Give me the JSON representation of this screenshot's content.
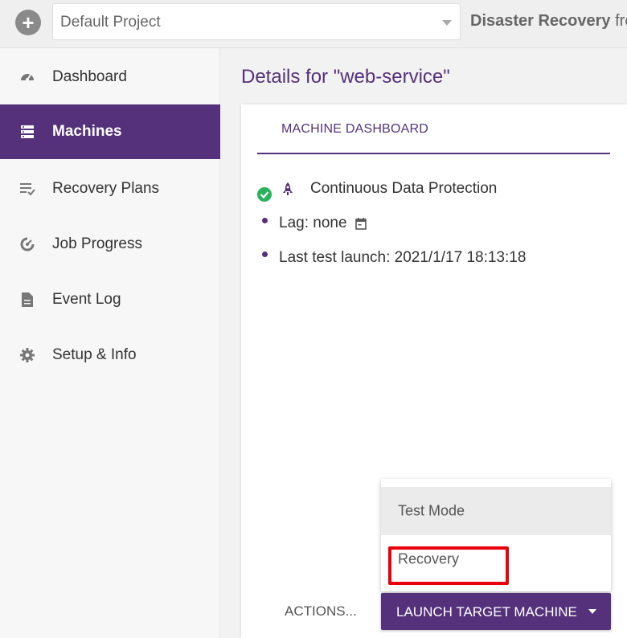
{
  "topbar": {
    "project_value": "Default Project",
    "app_title_bold": "Disaster Recovery",
    "app_title_rest": " from"
  },
  "sidebar": {
    "items": [
      {
        "label": "Dashboard",
        "icon": "gauge-icon"
      },
      {
        "label": "Machines",
        "icon": "server-icon",
        "active": true
      },
      {
        "label": "Recovery Plans",
        "icon": "checklist-icon"
      },
      {
        "label": "Job Progress",
        "icon": "progress-icon"
      },
      {
        "label": "Event Log",
        "icon": "document-icon"
      },
      {
        "label": "Setup & Info",
        "icon": "gear-icon"
      }
    ]
  },
  "main": {
    "title": "Details for \"web-service\"",
    "tab": "MACHINE DASHBOARD",
    "status": {
      "protection": "Continuous Data Protection",
      "lag": "Lag: none",
      "last_test": "Last test launch: 2021/1/17 18:13:18"
    },
    "menu": {
      "items": [
        "Test Mode",
        "Recovery"
      ]
    },
    "actions_label": "ACTIONS...",
    "launch_button": "LAUNCH TARGET MACHINE"
  },
  "colors": {
    "accent": "#54317a",
    "success": "#27b35a",
    "highlight": "#e8000b"
  }
}
